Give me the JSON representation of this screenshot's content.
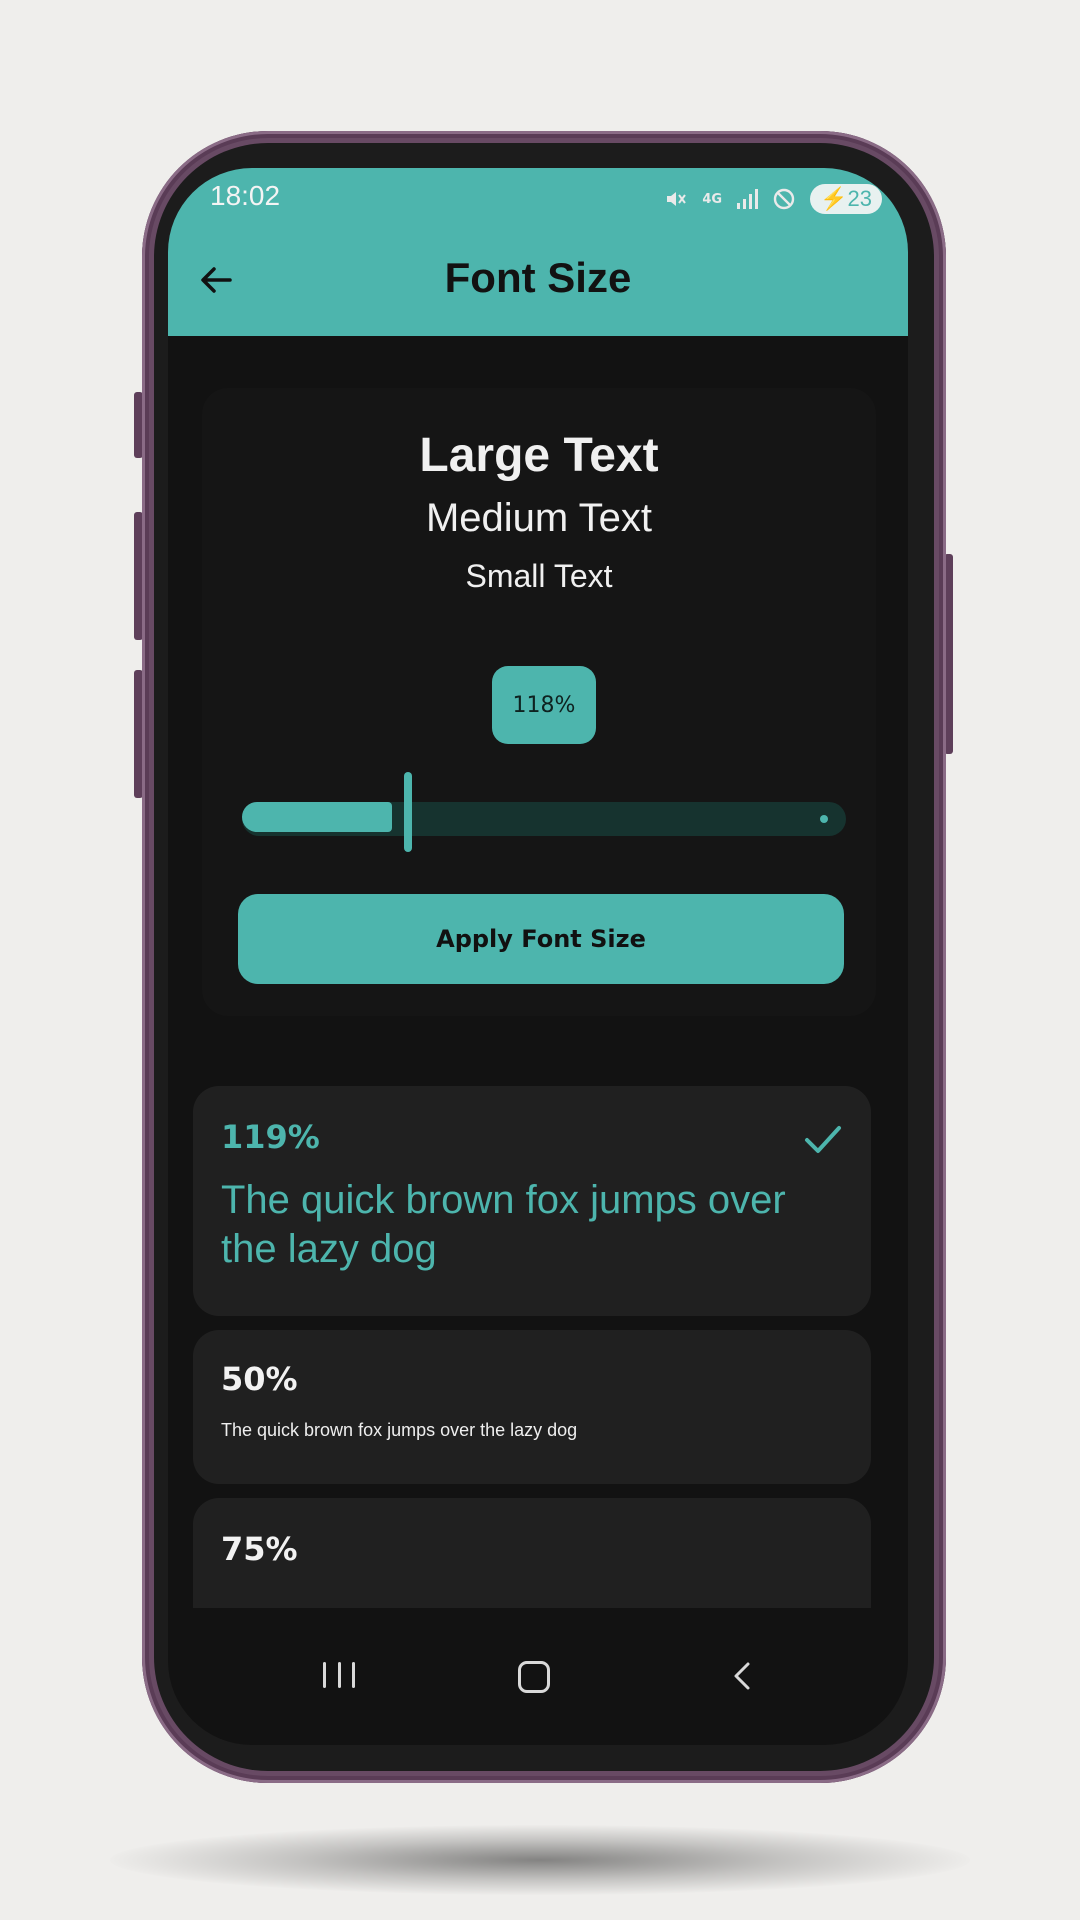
{
  "status_bar": {
    "time": "18:02",
    "icons": [
      "mute-icon",
      "4g-icon",
      "signal-icon",
      "dnd-icon"
    ],
    "network": "4G",
    "battery": "23"
  },
  "app_bar": {
    "title": "Font Size",
    "back_icon": "arrow-left-icon"
  },
  "preview": {
    "large": "Large Text",
    "medium": "Medium Text",
    "small": "Small Text",
    "percent": "118%",
    "slider_value": 0.23
  },
  "apply_button": "Apply Font Size",
  "options": [
    {
      "percent": "119%",
      "sample": "The quick brown fox jumps over the lazy dog",
      "selected": true
    },
    {
      "percent": "50%",
      "sample": "The quick brown fox jumps over the lazy dog",
      "selected": false
    },
    {
      "percent": "75%",
      "sample": "",
      "selected": false
    }
  ],
  "nav": {
    "recents_icon": "recents-icon",
    "home_icon": "home-icon",
    "back_icon": "chevron-left-icon"
  },
  "colors": {
    "accent": "#4db5ad",
    "background": "#121212",
    "card": "#202020"
  }
}
